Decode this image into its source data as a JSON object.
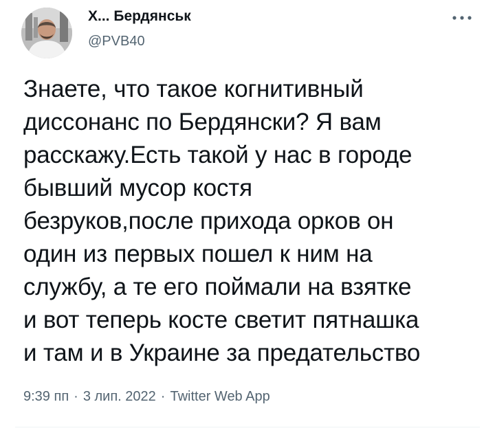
{
  "author": {
    "display_name": "Х... Бердянськ",
    "handle": "@PVB40"
  },
  "tweet": {
    "text": "Знаете, что такое когнитивный\nдиссонанс по Бердянски? Я вам\nрасскажу.Есть такой у нас в городе\nбывший мусор костя\nбезруков,после прихода орков он\nодин из первых пошел к ним на\nслужбу, а те его поймали на взятке\nи вот теперь косте светит пятнашка\nи там и в Украине за предательство"
  },
  "meta": {
    "time": "9:39 пп",
    "date": "3 лип. 2022",
    "source": "Twitter Web App",
    "separator": "·"
  },
  "icons": {
    "more": "more-horizontal-icon"
  },
  "colors": {
    "text": "#0f1419",
    "secondary": "#536471",
    "divider": "#eff3f4"
  }
}
